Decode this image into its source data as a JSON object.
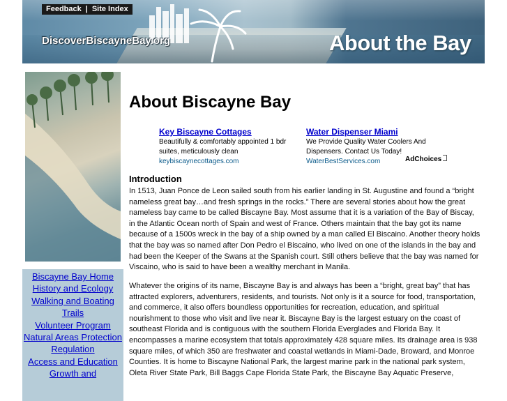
{
  "header": {
    "nav": [
      "Feedback",
      "Site Index"
    ],
    "nav_separator": "|",
    "logo_text": "DiscoverBiscayneBay.org",
    "banner_title": "About the Bay"
  },
  "sidebar": {
    "items": [
      "Biscayne Bay Home",
      "History and Ecology",
      "Walking and Boating Trails",
      "Volunteer Program",
      "Natural Areas Protection Regulation",
      "Access and Education",
      "Growth and"
    ]
  },
  "main": {
    "title": "About Biscayne Bay",
    "ads": [
      {
        "title": "Key Biscayne Cottages",
        "text": "Beautifully & comfortably appointed 1 bdr suites, meticulously clean",
        "url": "keybiscaynecottages.com"
      },
      {
        "title": "Water Dispenser Miami",
        "text": "We Provide Quality Water Coolers And Dispensers. Contact Us Today!",
        "url": "WaterBestServices.com"
      }
    ],
    "adchoices": "AdChoices",
    "section_heading": "Introduction",
    "paragraphs": [
      "In 1513, Juan Ponce de Leon sailed south from his earlier landing in St. Augustine and found a “bright nameless great bay…and fresh springs in the rocks.” There are several stories about how the great nameless bay came to be called Biscayne Bay. Most assume that it is a variation of the Bay of Biscay, in the Atlantic Ocean north of Spain and west of France. Others maintain that the bay got its name because of a 1500s wreck in the bay of a ship owned by a man called El Biscaino. Another theory holds that the bay was so named after Don Pedro el Biscaino, who lived on one of the islands in the bay and had been the Keeper of the Swans at the Spanish court. Still others believe that the bay was named for Viscaino, who is said to have been a wealthy merchant in Manila.",
      "Whatever the origins of its name, Biscayne Bay is and always has been a “bright, great bay” that has attracted explorers, adventurers, residents, and tourists. Not only is it a source for food, transportation, and commerce, it also offers boundless opportunities for recreation, education, and spiritual nourishment to those who visit and live near it. Biscayne Bay is the largest estuary on the coast of southeast Florida and is contiguous with the southern Florida Everglades and Florida Bay. It encompasses a marine ecosystem that totals approximately 428 square miles. Its drainage area is 938 square miles, of which 350 are freshwater and coastal wetlands in Miami-Dade, Broward, and Monroe Counties. It is home to Biscayne National Park, the largest marine park in the national park system, Oleta River State Park, Bill Baggs Cape Florida State Park, the Biscayne Bay Aquatic Preserve,"
    ]
  }
}
